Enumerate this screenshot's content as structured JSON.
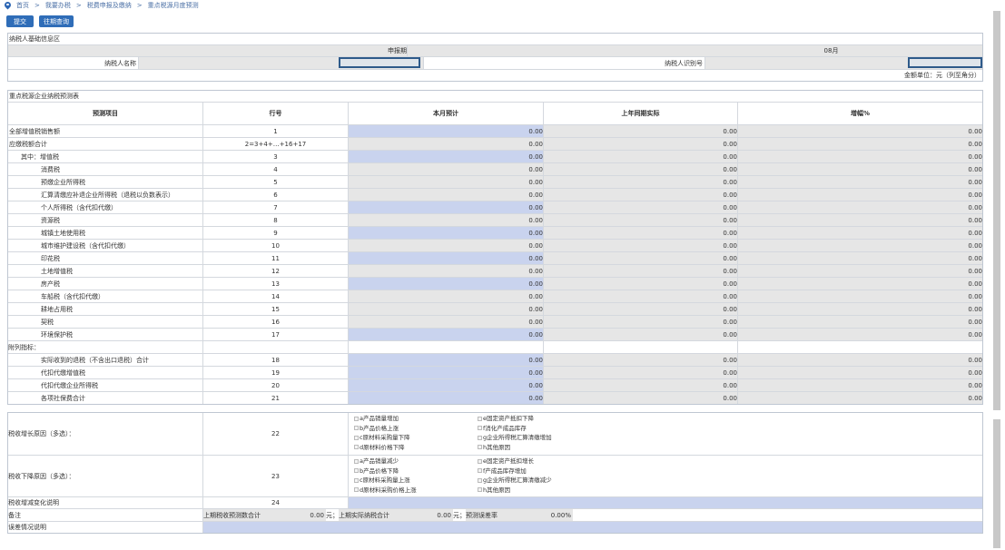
{
  "breadcrumb": {
    "home": "首页",
    "l1": "我要办税",
    "l2": "税费申报及缴纳",
    "l3": "重点税源月度预测"
  },
  "buttons": {
    "submit": "提交",
    "history": "往期查询"
  },
  "basic": {
    "section_title": "纳税人基础信息区",
    "period_label": "申报期",
    "period_value": "08月",
    "name_label": "纳税人名称",
    "id_label": "纳税人识别号",
    "unit_note": "金额单位：元（列至角分）"
  },
  "forecast": {
    "section_title": "重点税源企业纳税预测表",
    "headers": {
      "item": "预测项目",
      "line": "行号",
      "month": "本月预计",
      "last": "上年同期实际",
      "growth": "增幅%"
    },
    "rows": [
      {
        "name": "全部增值税销售额",
        "line": "1",
        "month": "0.00",
        "last": "0.00",
        "growth": "0.00",
        "indent": 0,
        "blue": true
      },
      {
        "name": "应缴税额合计",
        "line": "2=3+4+…+16+17",
        "month": "0.00",
        "last": "0.00",
        "growth": "0.00",
        "indent": 0,
        "blue": false
      },
      {
        "name": "其中：增值税",
        "line": "3",
        "month": "0.00",
        "last": "0.00",
        "growth": "0.00",
        "indent": 1,
        "blue": true
      },
      {
        "name": "消费税",
        "line": "4",
        "month": "0.00",
        "last": "0.00",
        "growth": "0.00",
        "indent": 2,
        "blue": false
      },
      {
        "name": "预缴企业所得税",
        "line": "5",
        "month": "0.00",
        "last": "0.00",
        "growth": "0.00",
        "indent": 2,
        "blue": false
      },
      {
        "name": "汇算清缴应补退企业所得税（退税以负数表示）",
        "line": "6",
        "month": "0.00",
        "last": "0.00",
        "growth": "0.00",
        "indent": 2,
        "blue": false
      },
      {
        "name": "个人所得税（含代扣代缴）",
        "line": "7",
        "month": "0.00",
        "last": "0.00",
        "growth": "0.00",
        "indent": 2,
        "blue": true
      },
      {
        "name": "资源税",
        "line": "8",
        "month": "0.00",
        "last": "0.00",
        "growth": "0.00",
        "indent": 2,
        "blue": false
      },
      {
        "name": "城镇土地使用税",
        "line": "9",
        "month": "0.00",
        "last": "0.00",
        "growth": "0.00",
        "indent": 2,
        "blue": true
      },
      {
        "name": "城市维护建设税（含代扣代缴）",
        "line": "10",
        "month": "0.00",
        "last": "0.00",
        "growth": "0.00",
        "indent": 2,
        "blue": false
      },
      {
        "name": "印花税",
        "line": "11",
        "month": "0.00",
        "last": "0.00",
        "growth": "0.00",
        "indent": 2,
        "blue": true
      },
      {
        "name": "土地增值税",
        "line": "12",
        "month": "0.00",
        "last": "0.00",
        "growth": "0.00",
        "indent": 2,
        "blue": false
      },
      {
        "name": "房产税",
        "line": "13",
        "month": "0.00",
        "last": "0.00",
        "growth": "0.00",
        "indent": 2,
        "blue": true
      },
      {
        "name": "车船税（含代扣代缴）",
        "line": "14",
        "month": "0.00",
        "last": "0.00",
        "growth": "0.00",
        "indent": 2,
        "blue": false
      },
      {
        "name": "耕地占用税",
        "line": "15",
        "month": "0.00",
        "last": "0.00",
        "growth": "0.00",
        "indent": 2,
        "blue": false
      },
      {
        "name": "契税",
        "line": "16",
        "month": "0.00",
        "last": "0.00",
        "growth": "0.00",
        "indent": 2,
        "blue": false
      },
      {
        "name": "环境保护税",
        "line": "17",
        "month": "0.00",
        "last": "0.00",
        "growth": "0.00",
        "indent": 2,
        "blue": true
      }
    ],
    "appendix_label": "附列指标：",
    "appendix": [
      {
        "name": "实际收到的退税（不含出口退税）合计",
        "line": "18",
        "month": "0.00",
        "last": "0.00",
        "growth": "0.00",
        "blue": true
      },
      {
        "name": "代扣代缴增值税",
        "line": "19",
        "month": "0.00",
        "last": "0.00",
        "growth": "0.00",
        "blue": true
      },
      {
        "name": "代扣代缴企业所得税",
        "line": "20",
        "month": "0.00",
        "last": "0.00",
        "growth": "0.00",
        "blue": true
      },
      {
        "name": "各项社保费合计",
        "line": "21",
        "month": "0.00",
        "last": "0.00",
        "growth": "0.00",
        "blue": true
      }
    ]
  },
  "reasons": {
    "increase_label": "税收增长原因（多选）：",
    "increase_line": "22",
    "increase_options": [
      "a产品销量增加",
      "b产品价格上涨",
      "c原材料采购量下降",
      "d原材料价格下降",
      "e固定资产抵扣下降",
      "f消化产成品库存",
      "g企业所得税汇算清缴增加",
      "h其他原因"
    ],
    "decrease_label": "税收下降原因（多选）：",
    "decrease_line": "23",
    "decrease_options": [
      "a产品销量减少",
      "b产品价格下降",
      "c原材料采购量上涨",
      "d原材料采购价格上涨",
      "e固定资产抵扣增长",
      "f产成品库存增加",
      "g企业所得税汇算清缴减少",
      "h其他原因"
    ],
    "change_label": "税收增减变化说明",
    "change_line": "24",
    "remark_label": "备注",
    "prev_forecast_label": "上期税收预测数合计",
    "prev_forecast_value": "0.00",
    "yuan1": "元；",
    "prev_actual_label": "上期实际纳税合计",
    "prev_actual_value": "0.00",
    "yuan2": "元；",
    "error_rate_label": "预测误差率",
    "error_rate_value": "0.00%",
    "error_note_label": "误差情况说明"
  }
}
